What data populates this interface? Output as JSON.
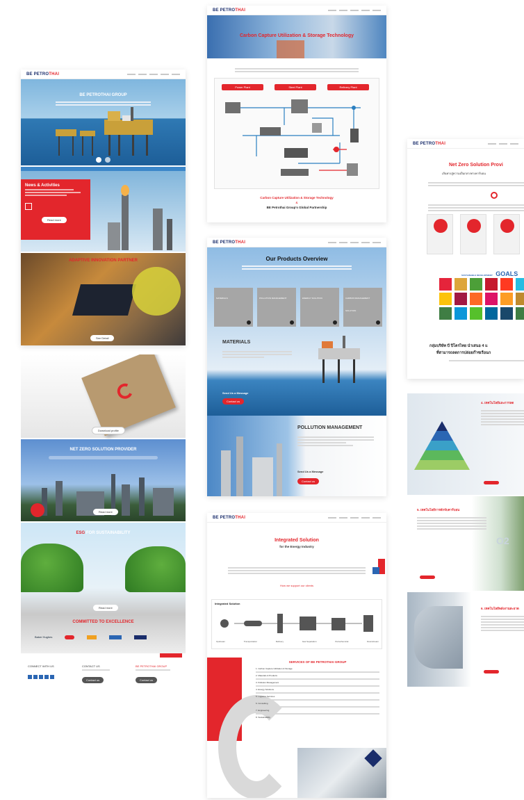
{
  "colors": {
    "brand_red": "#e3262c",
    "brand_navy": "#1a2d6b",
    "sea_blue": "#2f79b4"
  },
  "brand": {
    "logo_prefix": "BE PETRO",
    "logo_accent": "THAI",
    "logo_full": "BE PETROTHAI"
  },
  "left": {
    "hero_title": "BE PETROTHAI GROUP",
    "news_title": "News & Activities",
    "news_button": "Read more",
    "partner_title": "ADAPTIVE INNOVATION PARTNER",
    "partner_button": "See Detail",
    "folder_button": "Download profile",
    "netzero_title": "NET ZERO SOLUTION PROVIDER",
    "netzero_button": "Read more",
    "esg_title_accent": "ESG",
    "esg_title": " FOR SUSTAINABILITY",
    "esg_button": "Read more",
    "excellence_title_accent": "COMMITTED TO",
    "excellence_title": " EXCELLENCE",
    "partners": [
      "Baker Hughes",
      "",
      "",
      "",
      ""
    ],
    "footer_cols": [
      "CONNECT WITH US",
      "CONTACT US",
      "BE PETROTHAI GROUP"
    ],
    "footer_button": "Contact us"
  },
  "ccus": {
    "banner_title": "Carbon Capture Utilization & Storage Technology",
    "tabs": [
      "Power Plant",
      "Steel Plant",
      "Refinery Plant"
    ],
    "footer_line1": "Carbon Capture Utilization & Storage Technology",
    "footer_amp": "&",
    "footer_line2": "BE Petrothai Group's Global Partnership"
  },
  "products": {
    "title": "Our Products Overview",
    "cards": [
      "MATERIALS",
      "POLLUTION MANAGEMENT",
      "ENERGY SOLUTION",
      "CARBON MANAGEMENT SOLUTION"
    ],
    "materials_title": "MATERIALS",
    "materials_cta": "Send Us a Message",
    "materials_button": "Contact us",
    "pollution_title": "POLLUTION MANAGEMENT",
    "pollution_cta": "Send Us a Message",
    "pollution_button": "Contact us"
  },
  "integrated": {
    "title": "Integrated Solution",
    "subtitle": "for the Energy Industry",
    "link": "How we support our clients",
    "chain_title": "Integrated Solution",
    "chain_labels": [
      "Upstream",
      "Transportation",
      "Refinery",
      "Gas Separation",
      "Petrochemical",
      "Downstream"
    ]
  },
  "services": {
    "title": "SERVICES OF BE PETROTHAI GROUP",
    "items": [
      "1. Carbon Capture Utilization & Storage",
      "2. Materials & Products",
      "3. Pollution Management",
      "4. Energy Solutions",
      "5. Logistics Services",
      "6. Consulting",
      "7. Engineering",
      "8. Sustainability"
    ]
  },
  "netzero": {
    "title": "Net Zero Solution Provi",
    "subtitle": "เส้นทางสู่ความเป็นกลางทางคาร์บอน",
    "sdg_label": "SUSTAINABLE DEVELOPMENT",
    "sdg_goals": "GOALS",
    "thai_line1": "กลุ่มบริษัท บี ปิโตรไทย นำเสนอ 4 แ",
    "thai_line2": "ที่สามารถลดการปล่อยก๊าซเรือนก"
  },
  "thai_sections": {
    "s1": "4. เทคโนโลยีและการลด",
    "s2": "5. เทคโนโลยีการดักจับคาร์บอน",
    "s3": "6. เทคโนโลยีพลังงานสะอาด",
    "co2": "O2"
  }
}
